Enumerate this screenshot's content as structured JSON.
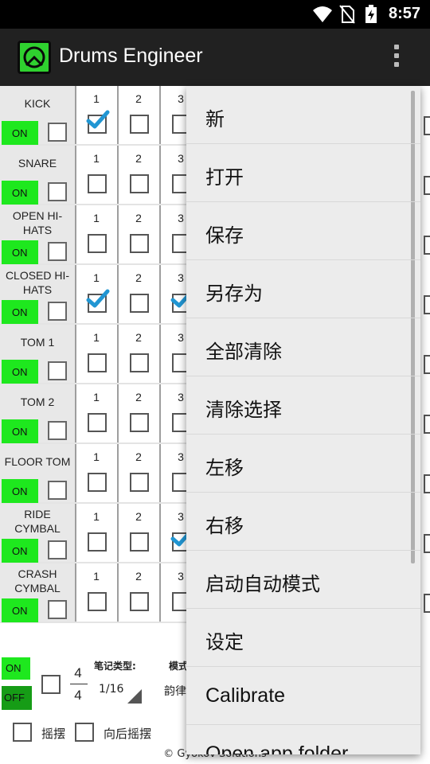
{
  "status_bar": {
    "time": "8:57",
    "icons": [
      "wifi-icon",
      "no-sim-icon",
      "battery-charging-icon"
    ]
  },
  "app_bar": {
    "title": "Drums Engineer",
    "logo_icon": "drum-logo-icon",
    "menu_icon": "more-vert-icon"
  },
  "tracks": [
    {
      "name": "KICK",
      "on_label": "ON",
      "steps": [
        {
          "num": "1",
          "checked": true
        },
        {
          "num": "2",
          "checked": false
        },
        {
          "num": "3",
          "checked": false
        }
      ]
    },
    {
      "name": "SNARE",
      "on_label": "ON",
      "steps": [
        {
          "num": "1",
          "checked": false
        },
        {
          "num": "2",
          "checked": false
        },
        {
          "num": "3",
          "checked": false
        }
      ]
    },
    {
      "name": "OPEN HI-HATS",
      "on_label": "ON",
      "steps": [
        {
          "num": "1",
          "checked": false
        },
        {
          "num": "2",
          "checked": false
        },
        {
          "num": "3",
          "checked": false
        }
      ]
    },
    {
      "name": "CLOSED HI-HATS",
      "on_label": "ON",
      "steps": [
        {
          "num": "1",
          "checked": true
        },
        {
          "num": "2",
          "checked": false
        },
        {
          "num": "3",
          "checked": true
        }
      ]
    },
    {
      "name": "TOM 1",
      "on_label": "ON",
      "steps": [
        {
          "num": "1",
          "checked": false
        },
        {
          "num": "2",
          "checked": false
        },
        {
          "num": "3",
          "checked": false
        }
      ]
    },
    {
      "name": "TOM 2",
      "on_label": "ON",
      "steps": [
        {
          "num": "1",
          "checked": false
        },
        {
          "num": "2",
          "checked": false
        },
        {
          "num": "3",
          "checked": false
        }
      ]
    },
    {
      "name": "FLOOR TOM",
      "on_label": "ON",
      "steps": [
        {
          "num": "1",
          "checked": false
        },
        {
          "num": "2",
          "checked": false
        },
        {
          "num": "3",
          "checked": false
        }
      ]
    },
    {
      "name": "RIDE CYMBAL",
      "on_label": "ON",
      "steps": [
        {
          "num": "1",
          "checked": false
        },
        {
          "num": "2",
          "checked": false
        },
        {
          "num": "3",
          "checked": true
        }
      ]
    },
    {
      "name": "CRASH CYMBAL",
      "on_label": "ON",
      "steps": [
        {
          "num": "1",
          "checked": false
        },
        {
          "num": "2",
          "checked": false
        },
        {
          "num": "3",
          "checked": false
        }
      ]
    }
  ],
  "bottom": {
    "on_label": "ON",
    "off_label": "OFF",
    "time_sig_top": "4",
    "time_sig_bottom": "4",
    "note_type_label": "笔记类型:",
    "note_type_value": "1/16",
    "mode_label": "模式",
    "mode_value": "韵律",
    "swing_label": "摇摆",
    "back_swing_label": "向后摇摆",
    "copyright": "© Gyokov Solutions"
  },
  "menu": {
    "items": [
      "新",
      "打开",
      "保存",
      "另存为",
      "全部清除",
      "清除选择",
      "左移",
      "右移",
      "启动自动模式",
      "设定",
      "Calibrate",
      "Open app folder"
    ]
  },
  "colors": {
    "on_green": "#1ee81e",
    "off_green": "#169c16",
    "check_blue": "#2196d3",
    "app_bar": "#212121"
  }
}
